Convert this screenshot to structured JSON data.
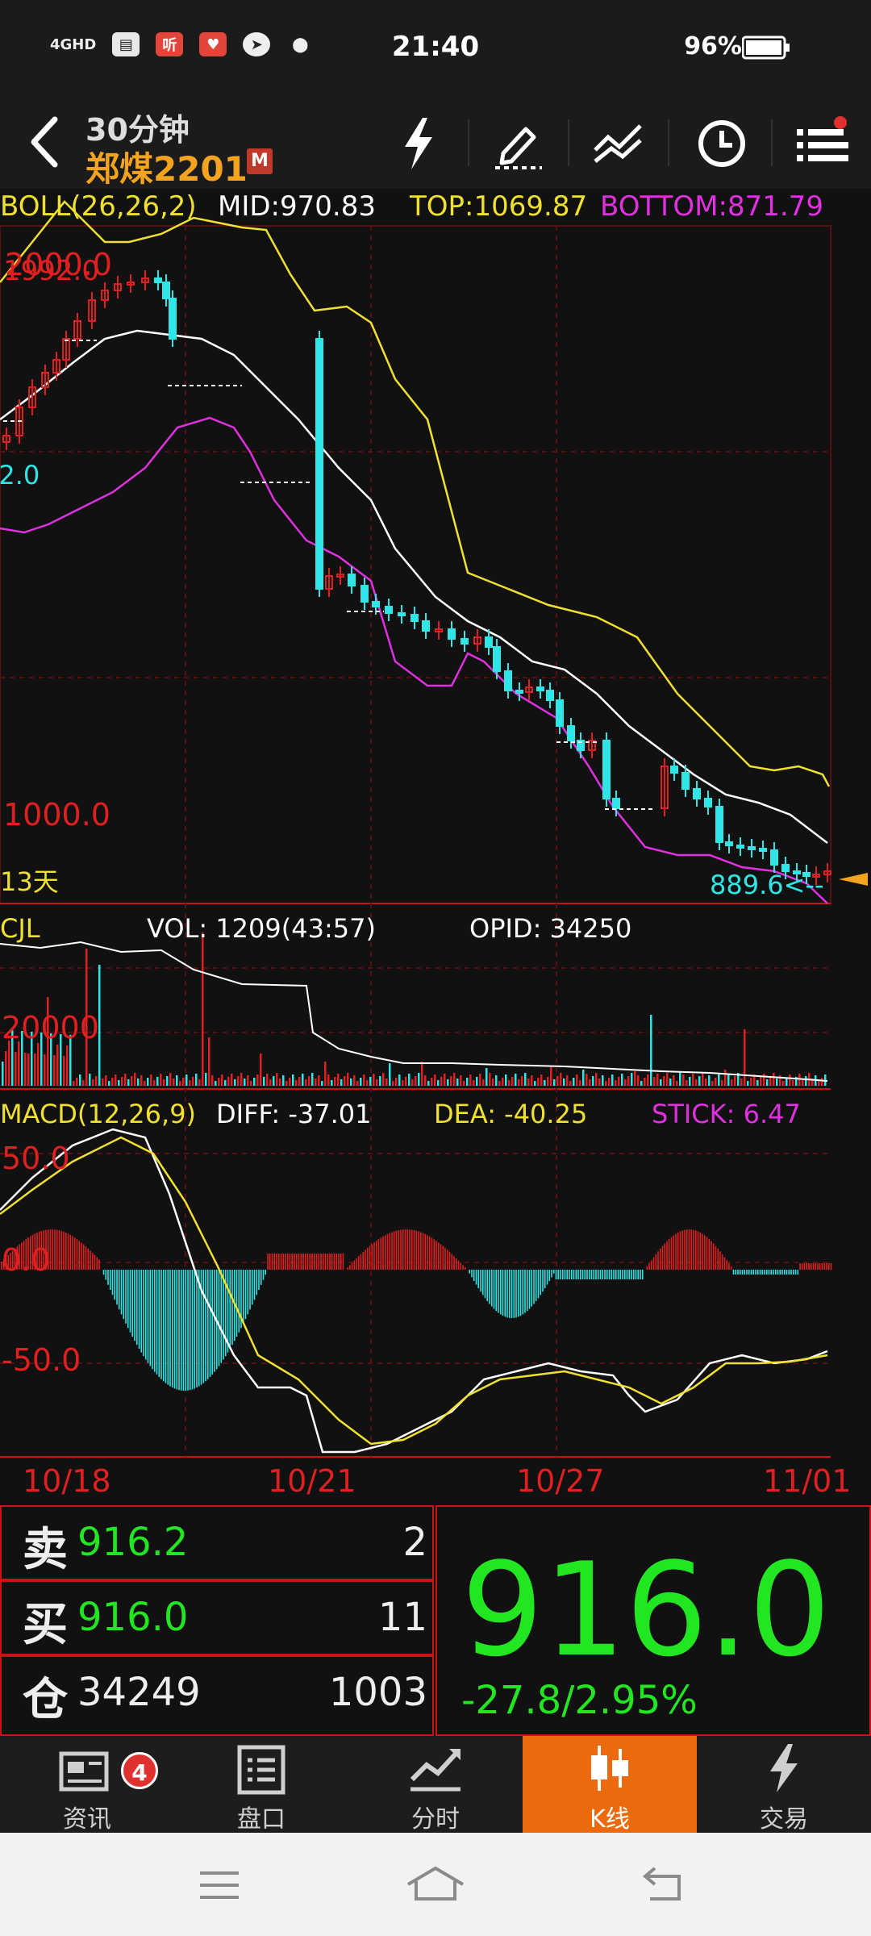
{
  "status_bar": {
    "time": "21:40",
    "battery": "96%",
    "network": "4GHD"
  },
  "header": {
    "period": "30分钟",
    "symbol": "郑煤2201",
    "badge": "M"
  },
  "boll": {
    "name": "BOLL(26,26,2)",
    "mid": "MID:970.83",
    "top": "TOP:1069.87",
    "bottom": "BOTTOM:871.79"
  },
  "main_chart": {
    "price_labels": {
      "high_overlap": "2000.0",
      "high_overlap2": "1992.0",
      "high": "1992.0",
      "left_mid": "92.0",
      "low": "1000.0",
      "last_low": "889.6<--",
      "days": "13天"
    }
  },
  "volume": {
    "name": "CJL",
    "vol": "VOL: 1209(43:57)",
    "opid": "OPID: 34250",
    "axis": "20000"
  },
  "macd": {
    "name": "MACD(12,26,9)",
    "diff": "DIFF: -37.01",
    "dea": "DEA: -40.25",
    "stick": "STICK: 6.47",
    "axis_top": "50.0",
    "axis_zero": "0.0",
    "axis_bottom": "-50.0"
  },
  "dates": [
    "10/18",
    "10/21",
    "10/27",
    "11/01"
  ],
  "quote": {
    "sell_label": "卖",
    "sell_price": "916.2",
    "sell_qty": "2",
    "buy_label": "买",
    "buy_price": "916.0",
    "buy_qty": "11",
    "oi_label": "仓",
    "oi_value": "34249",
    "oi_change": "1003",
    "last_price": "916.0",
    "change": "-27.8/2.95%"
  },
  "tabs": [
    {
      "label": "资讯",
      "badge": "4"
    },
    {
      "label": "盘口"
    },
    {
      "label": "分时"
    },
    {
      "label": "K线"
    },
    {
      "label": "交易"
    }
  ],
  "colors": {
    "up": "#e02020",
    "down": "#2ee6e6",
    "mid": "#ffffff",
    "top": "#f0e030",
    "bottom": "#e030e0",
    "accent": "#ed6a0c",
    "price_green": "#23e623"
  }
}
